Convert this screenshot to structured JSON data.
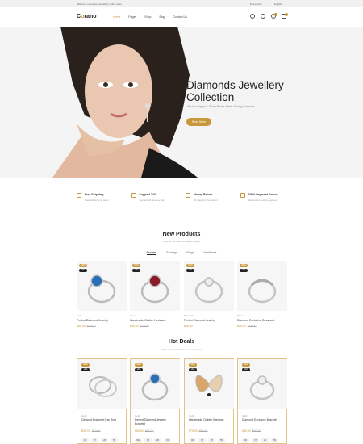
{
  "topbar": {
    "welcome": "Welcome to Corano Jewellery online store",
    "currency": "$ Currency",
    "language": "English"
  },
  "header": {
    "logo_prefix": "C",
    "logo_o": "o",
    "logo_suffix": "rano",
    "nav": [
      "Home",
      "Pages",
      "Shop",
      "Blog",
      "Contact Us"
    ],
    "icons": [
      "search-icon",
      "user-icon",
      "heart-icon",
      "cart-icon"
    ]
  },
  "hero": {
    "title": "Diamonds Jewellery Collection",
    "subtitle": "Shukra Yogam & Silver Power Silver Saving Schemes.",
    "button": "Read More"
  },
  "features": [
    {
      "title": "Free Shipping",
      "desc": "Free shipping all order"
    },
    {
      "title": "Support 24/7",
      "desc": "Support 24 hours a day"
    },
    {
      "title": "Money Return",
      "desc": "30 days for free return"
    },
    {
      "title": "100% Payment Secure",
      "desc": "We ensure secure payment"
    }
  ],
  "new_products": {
    "title": "New Products",
    "subtitle": "Add our products to weekly lineup",
    "tabs": [
      "Bracelet",
      "Earrings",
      "Rings",
      "Necklaces"
    ],
    "items": [
      {
        "tag_new": "NEW",
        "tag_sale": "10%",
        "category": "Gold",
        "name": "Perfect Diamond Jewelry",
        "price": "$60.00",
        "old_price": "$70.00"
      },
      {
        "tag_new": "NEW",
        "tag_sale": "10%",
        "category": "Rose",
        "name": "Handmade Golden Necklace",
        "price": "$55.00",
        "old_price": "$70.00"
      },
      {
        "tag_new": "NEW",
        "tag_sale": "10%",
        "category": "Diamond",
        "name": "Perfect Diamond Jewelry",
        "price": "$99.00",
        "old_price": ""
      },
      {
        "tag_new": "NEW",
        "tag_sale": "10%",
        "category": "Silver",
        "name": "Diamond Exclusive Ornament",
        "price": "$55.00",
        "old_price": "$75.00"
      }
    ]
  },
  "hot_deals": {
    "title": "Hot Deals",
    "subtitle": "Add featured products to weekly lineup",
    "items": [
      {
        "tag_new": "NEW",
        "tag_sale": "10%",
        "category": "Gold",
        "name": "Citygold Exclusive Ear Ring",
        "price": "$30.00",
        "old_price": "$40.00",
        "countdown": [
          "00",
          "07",
          "26",
          "55"
        ]
      },
      {
        "tag_new": "NEW",
        "tag_sale": "10%",
        "category": "Gold",
        "name": "Perfect Diamond Jewelry Bracelet",
        "price": "$60.00",
        "old_price": "$80.00",
        "countdown": [
          "662",
          "17",
          "26",
          "33"
        ]
      },
      {
        "tag_new": "NEW",
        "tag_sale": "10%",
        "category": "Gold",
        "name": "Handmade Golden Earrings",
        "price": "$70.00",
        "old_price": "$80.00",
        "countdown": [
          "00",
          "07",
          "26",
          "55"
        ]
      },
      {
        "tag_new": "NEW",
        "tag_sale": "10%",
        "category": "Gold",
        "name": "Diamond Exclusive Bracelet",
        "price": "$50.00",
        "old_price": "$60.00",
        "countdown": [
          "00",
          "07",
          "26",
          "55"
        ]
      }
    ]
  },
  "colors": {
    "accent": "#c8973a",
    "dark": "#222222"
  }
}
